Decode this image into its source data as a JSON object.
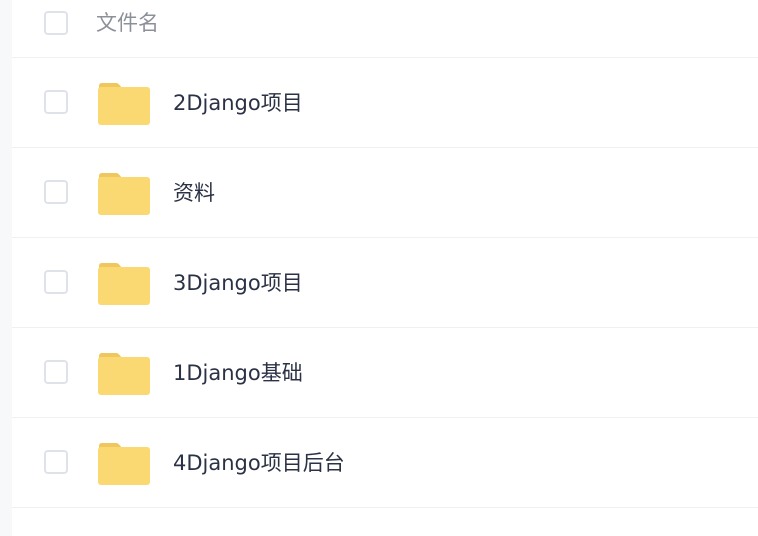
{
  "header": {
    "name_column_label": "文件名"
  },
  "files": [
    {
      "name": "2Django项目",
      "type": "folder",
      "icon": "folder-icon"
    },
    {
      "name": "资料",
      "type": "folder",
      "icon": "folder-icon"
    },
    {
      "name": "3Django项目",
      "type": "folder",
      "icon": "folder-icon"
    },
    {
      "name": "1Django基础",
      "type": "folder",
      "icon": "folder-icon"
    },
    {
      "name": "4Django项目后台",
      "type": "folder",
      "icon": "folder-icon"
    }
  ],
  "colors": {
    "folder_body": "#fad872",
    "folder_tab": "#f0c75e",
    "checkbox_border": "#dfe2e8",
    "divider": "#eef0f3",
    "header_text": "#8c9099",
    "name_text": "#2b3245"
  }
}
